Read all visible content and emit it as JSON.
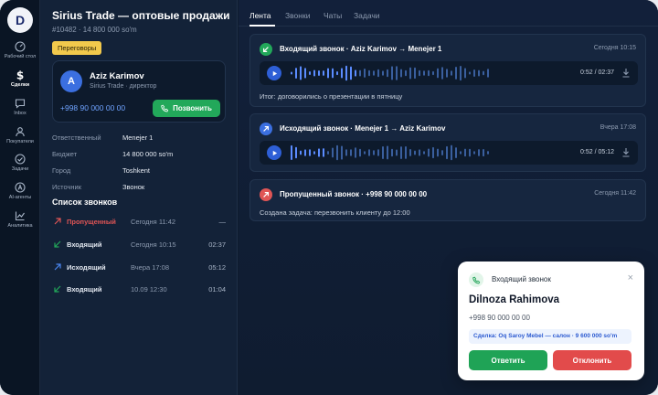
{
  "sidebar": {
    "logo": "D",
    "items": [
      {
        "label": "Рабочий стол",
        "icon": "dashboard-icon"
      },
      {
        "label": "Сделки",
        "icon": "dollar-icon",
        "active": true
      },
      {
        "label": "Inbox",
        "icon": "chat-icon"
      },
      {
        "label": "Покупатели",
        "icon": "user-icon"
      },
      {
        "label": "Задачи",
        "icon": "check-circle-icon"
      },
      {
        "label": "AI-агенты",
        "icon": "ai-agent-icon"
      },
      {
        "label": "Аналитика",
        "icon": "chart-icon"
      }
    ]
  },
  "deal": {
    "title": "Sirius Trade — оптовые продажи",
    "subtitle": "#10482 · 14 800 000 so'm",
    "stage": "Переговоры"
  },
  "contact": {
    "initial": "A",
    "name": "Aziz Karimov",
    "role": "Sirius Trade · директор",
    "phone": "+998 90 000 00 00",
    "call_label": "Позвонить"
  },
  "info": [
    {
      "key": "Ответственный",
      "value": "Menejer 1"
    },
    {
      "key": "Бюджет",
      "value": "14 800 000 so'm"
    },
    {
      "key": "Город",
      "value": "Toshkent"
    },
    {
      "key": "Источник",
      "value": "Звонок"
    }
  ],
  "calls": {
    "heading": "Список звонков",
    "rows": [
      {
        "type": "missed",
        "label": "Пропущенный",
        "time": "Сегодня 11:42",
        "duration": "—"
      },
      {
        "type": "incoming",
        "label": "Входящий",
        "time": "Сегодня 10:15",
        "duration": "02:37"
      },
      {
        "type": "outgoing",
        "label": "Исходящий",
        "time": "Вчера 17:08",
        "duration": "05:12"
      },
      {
        "type": "incoming",
        "label": "Входящий",
        "time": "10.09 12:30",
        "duration": "01:04"
      }
    ]
  },
  "tabs": [
    "Лента",
    "Звонки",
    "Чаты",
    "Задачи"
  ],
  "feed": [
    {
      "type": "incoming",
      "title": "Входящий звонок · Aziz Karimov → Menejer 1",
      "time": "Сегодня 10:15",
      "player_time": "0:52 / 02:37",
      "progress": 0.33,
      "note": "Итог: договорились о презентации в пятницу"
    },
    {
      "type": "outgoing",
      "title": "Исходящий звонок · Menejer 1 → Aziz Karimov",
      "time": "Вчера 17:08",
      "player_time": "0:52 / 05:12",
      "progress": 0.17,
      "note": ""
    },
    {
      "type": "missed",
      "title": "Пропущенный звонок · +998 90 000 00 00",
      "time": "Сегодня 11:42",
      "note": "Создана задача: перезвонить клиенту до 12:00"
    }
  ],
  "popup": {
    "title": "Входящий звонок",
    "name": "Dilnoza Rahimova",
    "phone": "+998 90 000 00 00",
    "deal": "Сделка: Oq Saroy Mebel — салон · 9 600 000 so'm",
    "accept": "Ответить",
    "decline": "Отклонить",
    "close": "×"
  },
  "colors": {
    "accent": "#2e5fd6",
    "incoming": "#22a85a",
    "outgoing": "#3b6fe0",
    "missed": "#e05555",
    "stage": "#f2c94c"
  }
}
